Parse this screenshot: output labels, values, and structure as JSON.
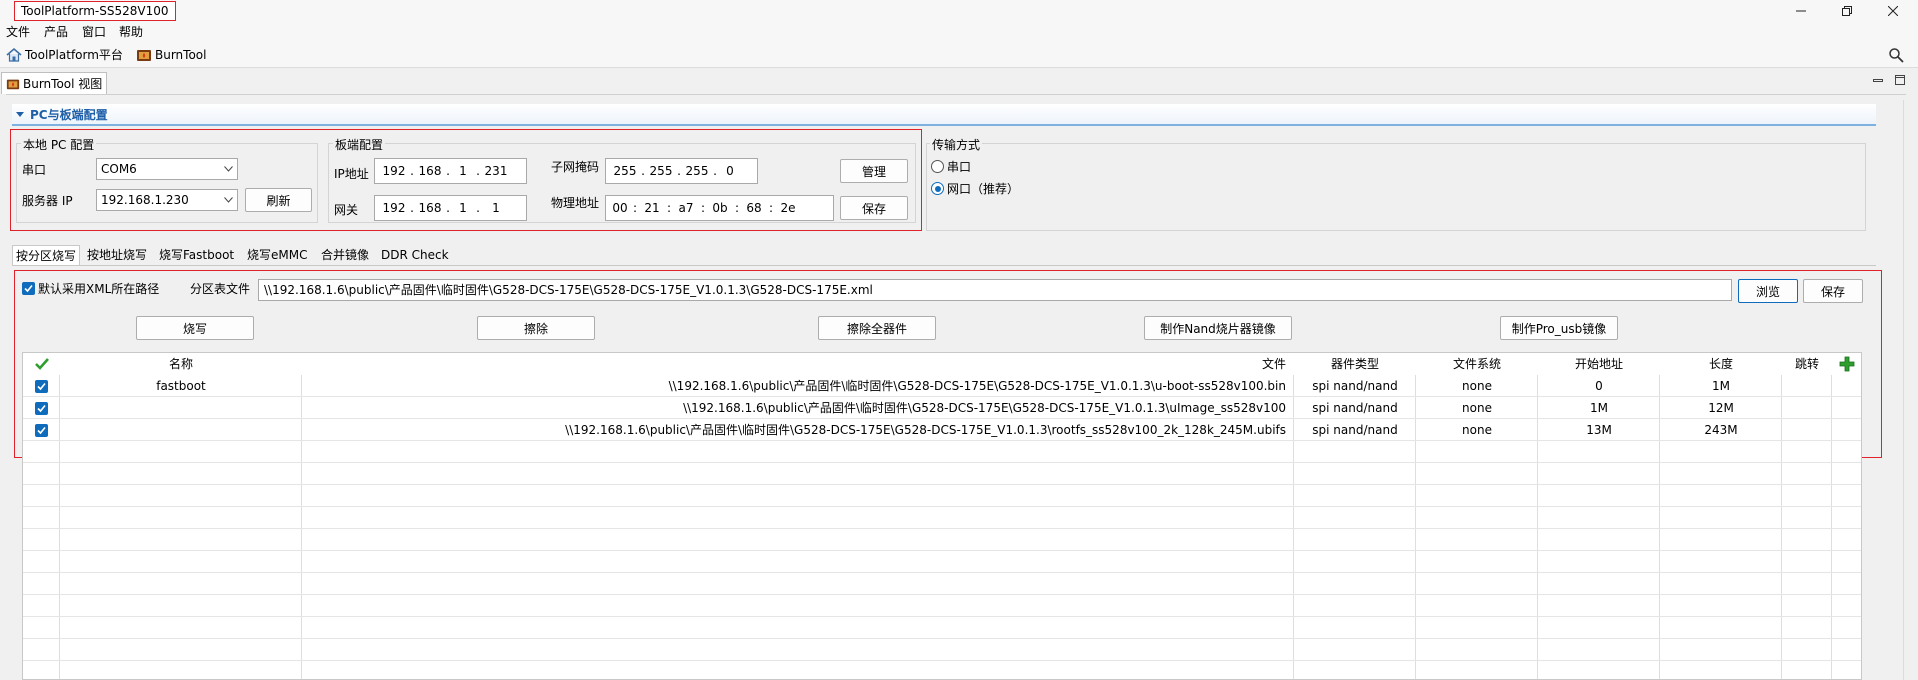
{
  "window": {
    "title": "ToolPlatform-SS528V100"
  },
  "menu": [
    "文件",
    "产品",
    "窗口",
    "帮助"
  ],
  "toolbar": {
    "platform_label": "ToolPlatform平台",
    "burntool_label": "BurnTool"
  },
  "view_tab": {
    "label": "BurnTool 视图"
  },
  "section": {
    "title": "PC与板端配置"
  },
  "local_pc": {
    "group_label": "本地 PC 配置",
    "serial_label": "串口",
    "serial_value": "COM6",
    "server_ip_label": "服务器 IP",
    "server_ip_value": "192.168.1.230",
    "refresh_label": "刷新"
  },
  "board": {
    "group_label": "板端配置",
    "ip_label": "IP地址",
    "ip": [
      "192",
      "168",
      "1",
      "231"
    ],
    "gateway_label": "网关",
    "gateway": [
      "192",
      "168",
      "1",
      "1"
    ],
    "mask_label": "子网掩码",
    "mask": [
      "255",
      "255",
      "255",
      "0"
    ],
    "mac_label": "物理地址",
    "mac": [
      "00",
      "21",
      "a7",
      "0b",
      "68",
      "2e"
    ],
    "manage_label": "管理",
    "save_label": "保存"
  },
  "transfer": {
    "group_label": "传输方式",
    "serial_option": "串口",
    "network_option": "网口（推荐）",
    "selected": "network"
  },
  "burn_tabs": [
    "按分区烧写",
    "按地址烧写",
    "烧写Fastboot",
    "烧写eMMC",
    "合并镜像",
    "DDR Check"
  ],
  "partition": {
    "use_xml_label": "默认采用XML所在路径",
    "use_xml_checked": true,
    "table_file_label": "分区表文件",
    "table_file_path": "\\\\192.168.1.6\\public\\产品固件\\临时固件\\G528-DCS-175E\\G528-DCS-175E_V1.0.1.3\\G528-DCS-175E.xml",
    "browse_label": "浏览",
    "save_label": "保存",
    "actions": {
      "burn": "烧写",
      "erase": "擦除",
      "erase_all": "擦除全器件",
      "make_nand": "制作Nand烧片器镜像",
      "make_pro_usb": "制作Pro_usb镜像"
    }
  },
  "table": {
    "headers": {
      "name": "名称",
      "file": "文件",
      "device": "器件类型",
      "fs": "文件系统",
      "start": "开始地址",
      "length": "长度",
      "jump": "跳转"
    },
    "rows": [
      {
        "name": "fastboot",
        "file": "\\\\192.168.1.6\\public\\产品固件\\临时固件\\G528-DCS-175E\\G528-DCS-175E_V1.0.1.3\\u-boot-ss528v100.bin",
        "device": "spi nand/nand",
        "fs": "none",
        "start": "0",
        "length": "1M"
      },
      {
        "name": "",
        "file": "\\\\192.168.1.6\\public\\产品固件\\临时固件\\G528-DCS-175E\\G528-DCS-175E_V1.0.1.3\\uImage_ss528v100",
        "device": "spi nand/nand",
        "fs": "none",
        "start": "1M",
        "length": "12M"
      },
      {
        "name": "",
        "file": "\\\\192.168.1.6\\public\\产品固件\\临时固件\\G528-DCS-175E\\G528-DCS-175E_V1.0.1.3\\rootfs_ss528v100_2k_128k_245M.ubifs",
        "device": "spi nand/nand",
        "fs": "none",
        "start": "13M",
        "length": "243M"
      }
    ]
  },
  "colors": {
    "highlight_red": "#e0222b",
    "accent_blue": "#0f6cbd",
    "add_green": "#2e9e2e"
  },
  "icons": [
    "minimize-icon",
    "restore-icon",
    "close-icon",
    "home-icon",
    "burntool-icon",
    "search-icon",
    "checkmark-icon",
    "plus-icon",
    "chevron-down-icon"
  ]
}
